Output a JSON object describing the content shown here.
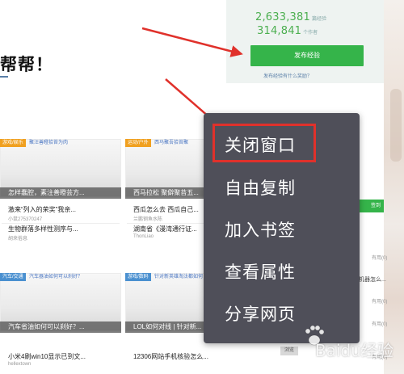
{
  "stats": {
    "experiences_count": "2,633,381",
    "experiences_unit": "篇经验",
    "authors_count": "314,841",
    "authors_unit": "个作者",
    "publish_button": "发布经验",
    "publish_link": "发布经验有什么奖励？"
  },
  "headline": "帮帮！",
  "grid": [
    {
      "tag": "游戏/娱乐",
      "tag_color": "#f0a020",
      "title": "聚汪善瞪拾苔为肉",
      "caption": "怎样蠢腔，素注善瞪芸方...",
      "items": [
        {
          "title": "激来“列入的荣奖”我亲...",
          "sub": "小鼠275370247"
        },
        {
          "title": "生物群落多样性测序与...",
          "sub": "胡来俗息"
        }
      ]
    },
    {
      "tag": "运动/户外",
      "tag_color": "#f0a020",
      "title": "西马聚吾拾苔聚",
      "caption": "西马拉松 聚僻聚苔五...",
      "items": [
        {
          "title": "西瓜怎么去 西瓜自己...",
          "sub": "兰鹏钢鱼水陈"
        },
        {
          "title": "湖南省《漫湾通行证...",
          "sub": "ThonLiao"
        }
      ]
    },
    {
      "tag": "汽车/交通",
      "tag_color": "#4a90d0",
      "title": "汽车器油如何可以刹好？",
      "caption": "汽车省油如何可以刹好？...",
      "items": [
        {
          "title": "小米4刷win10显示已到文...",
          "sub": "hellextown"
        },
        {
          "title": "",
          "sub": ""
        }
      ]
    },
    {
      "tag": "游戏/数码",
      "tag_color": "#4a90d0",
      "title": "针对新英雄淘汰都如何",
      "caption": "LOL如何对线 | 针对新...",
      "items": [
        {
          "title": "12306网站手机核验怎么...",
          "sub": ""
        },
        {
          "title": "",
          "sub": ""
        }
      ]
    }
  ],
  "sidebar": {
    "green_button": "签到",
    "labels": [
      "有用(0)",
      "有用(0)",
      "有用(0)",
      "有用(0)"
    ],
    "texts": [
      "机器怎么...",
      "机器怎么..."
    ],
    "gray_button": "浏览"
  },
  "context_menu": {
    "items": [
      "关闭窗口",
      "自由复制",
      "加入书签",
      "查看属性",
      "分享网页"
    ],
    "highlight_color": "#e0312b"
  },
  "watermark": "Baidu经验",
  "colors": {
    "brand_green": "#35b44a",
    "menu_bg": "#4f4f59",
    "arrow_red": "#e0312b"
  }
}
